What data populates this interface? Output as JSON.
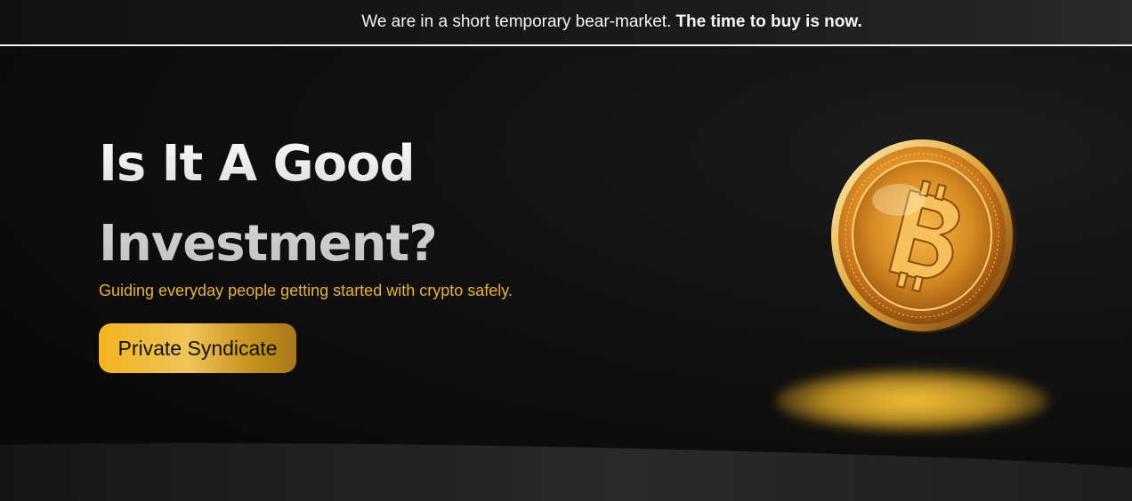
{
  "announcement": {
    "text": "We are in a short temporary bear-market.",
    "bold_text": "The time to buy is now."
  },
  "hero": {
    "title_line1": "Is It A Good",
    "title_line2": "Investment?",
    "subtitle": "Guiding everyday people getting started with crypto safely.",
    "cta_label": "Private Syndicate"
  },
  "colors": {
    "background": "#0b0b0b",
    "accent_gold": "#e9b23a",
    "title_silver": "#d8d8d8",
    "announce_text": "#f4f4f4"
  },
  "icons": {
    "coin": "bitcoin-coin-icon"
  }
}
